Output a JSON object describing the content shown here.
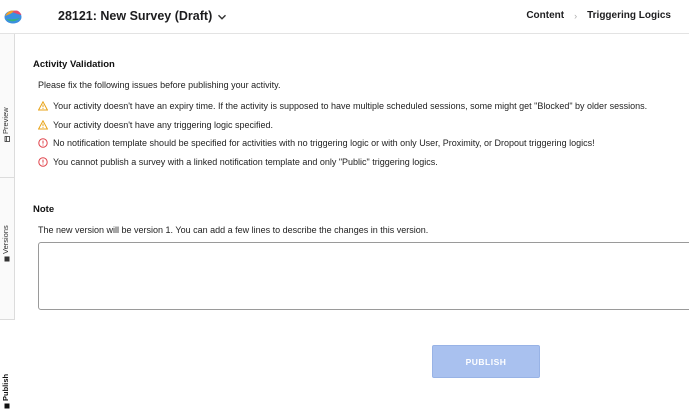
{
  "header": {
    "survey_title": "28121: New Survey (Draft)",
    "breadcrumbs": [
      {
        "label": "Content"
      },
      {
        "label": "Triggering Logics"
      }
    ]
  },
  "left_rail": {
    "tabs": [
      {
        "label": "Preview",
        "icon": "calendar-icon"
      },
      {
        "label": "Versions",
        "icon": "list-icon"
      },
      {
        "label": "Publish",
        "icon": "publish-icon"
      }
    ]
  },
  "validation": {
    "title": "Activity Validation",
    "intro": "Please fix the following issues before publishing your activity.",
    "issues": [
      {
        "severity": "warning",
        "icon": "warning-icon",
        "text": "Your activity doesn't have an expiry time. If the activity is supposed to have multiple scheduled sessions, some might get \"Blocked\" by older sessions."
      },
      {
        "severity": "warning",
        "icon": "warning-icon",
        "text": "Your activity doesn't have any triggering logic specified."
      },
      {
        "severity": "error",
        "icon": "error-icon",
        "text": "No notification template should be specified for activities with no triggering logic or with only User, Proximity, or Dropout triggering logics!"
      },
      {
        "severity": "error",
        "icon": "error-icon",
        "text": "You cannot publish a survey with a linked notification template and only \"Public\" triggering logics."
      }
    ]
  },
  "note": {
    "title": "Note",
    "description": "The new version will be version 1. You can add a few lines to describe the changes in this version.",
    "value": "",
    "placeholder": ""
  },
  "actions": {
    "publish_label": "PUBLISH"
  },
  "colors": {
    "warning": "#e8a317",
    "error": "#e0424a",
    "publish_button": "#a9c1ef"
  }
}
